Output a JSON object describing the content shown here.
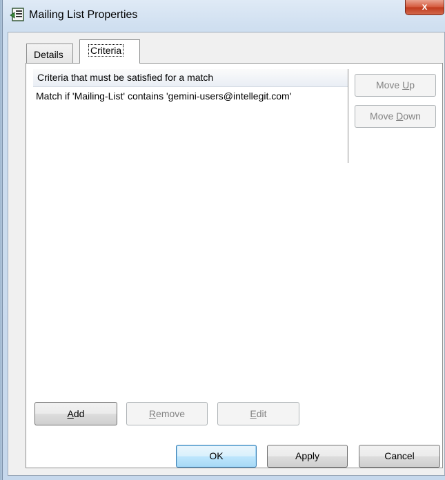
{
  "window": {
    "title": "Mailing List Properties",
    "close_label": "x"
  },
  "tabs": [
    {
      "label": "Details",
      "selected": false
    },
    {
      "label": "Criteria",
      "selected": true
    }
  ],
  "criteria_list": {
    "header": "Criteria that must be satisfied for a match",
    "rows": [
      "Match if 'Mailing-List' contains 'gemini-users@intellegit.com'"
    ]
  },
  "side_buttons": {
    "move_up": {
      "pre": "Move ",
      "key": "U",
      "post": "p",
      "enabled": false
    },
    "move_down": {
      "pre": "Move ",
      "key": "D",
      "post": "own",
      "enabled": false
    }
  },
  "action_buttons": {
    "add": {
      "pre": "",
      "key": "A",
      "post": "dd",
      "enabled": true
    },
    "remove": {
      "pre": "",
      "key": "R",
      "post": "emove",
      "enabled": false
    },
    "edit": {
      "pre": "",
      "key": "E",
      "post": "dit",
      "enabled": false
    }
  },
  "dialog_buttons": {
    "ok": "OK",
    "apply": "Apply",
    "cancel": "Cancel"
  }
}
